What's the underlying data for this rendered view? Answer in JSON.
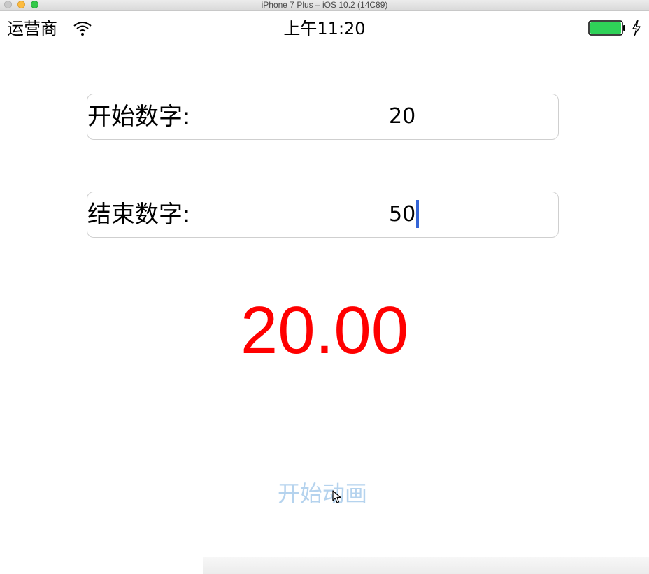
{
  "window": {
    "title": "iPhone 7 Plus – iOS 10.2 (14C89)"
  },
  "status_bar": {
    "carrier": "运营商",
    "time": "上午11:20",
    "wifi_icon": "wifi-icon",
    "battery_icon": "battery-icon",
    "charging_icon": "bolt-icon",
    "battery_color": "#2fd158"
  },
  "form": {
    "start_label": "开始数字:",
    "start_value": "20",
    "end_label": "结束数字:",
    "end_value": "50"
  },
  "counter": {
    "value": "20.00",
    "color": "#ff0000"
  },
  "action": {
    "button_label": "开始动画",
    "button_color": "#b5d3ee"
  }
}
